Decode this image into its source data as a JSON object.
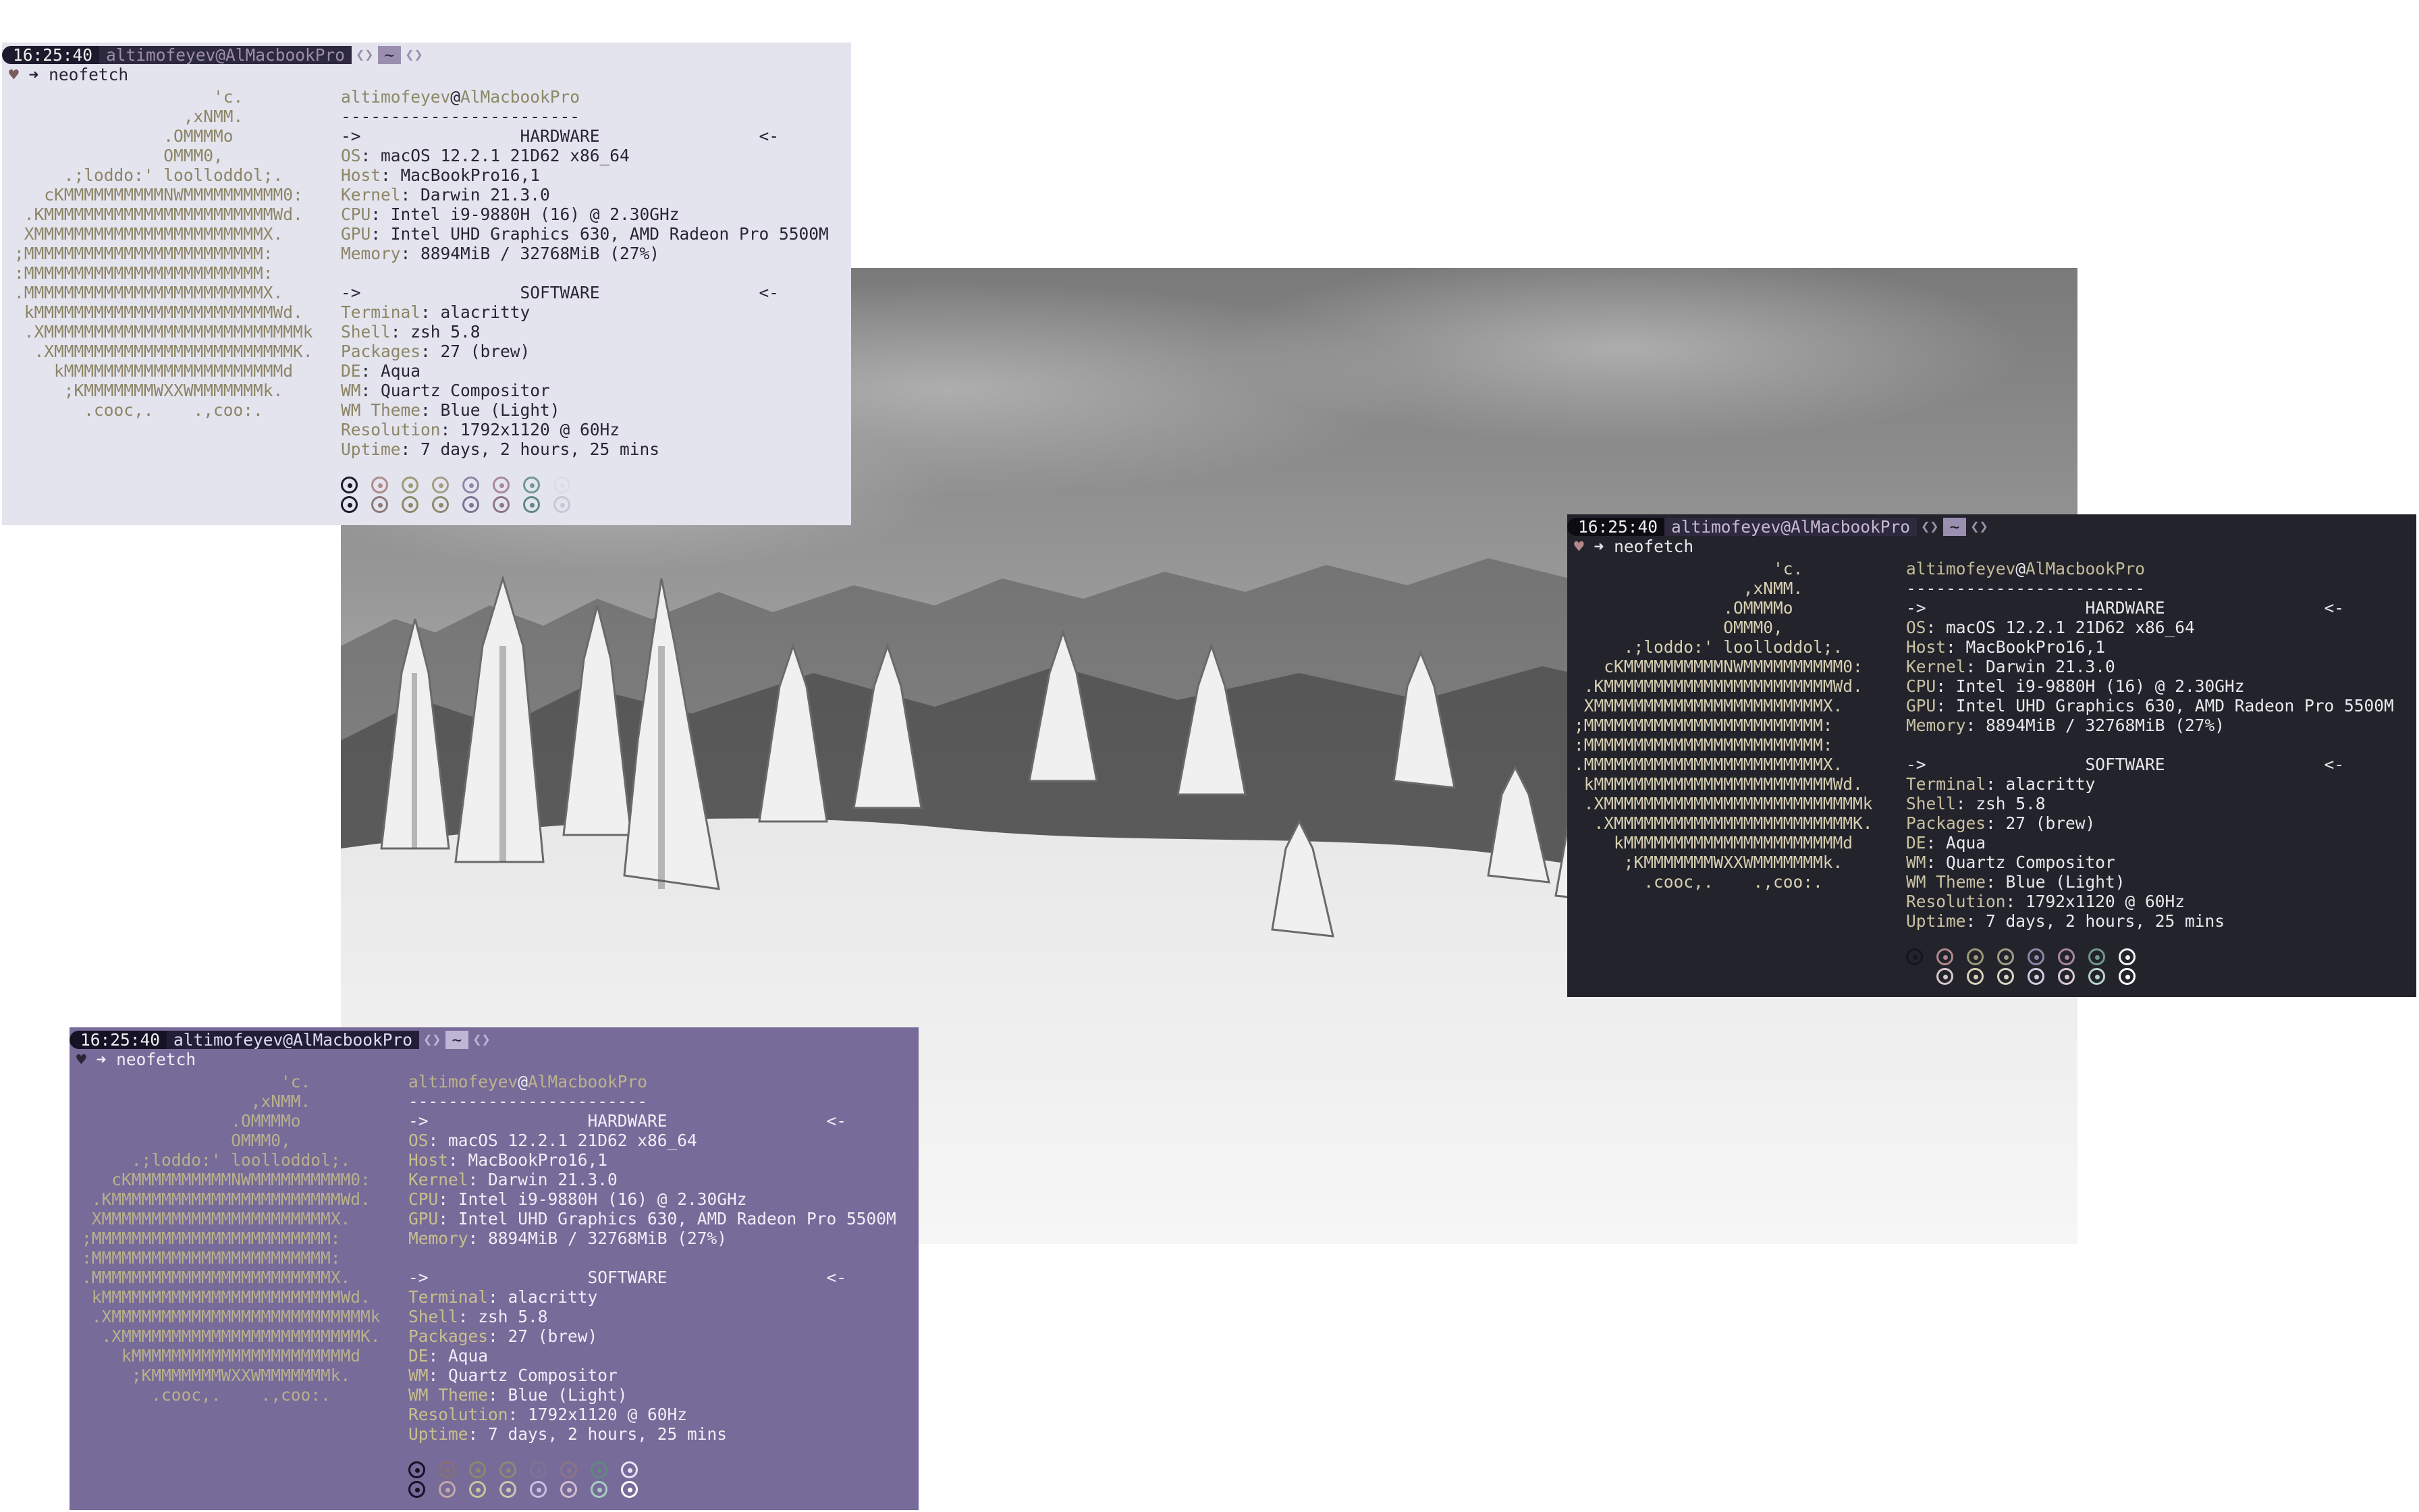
{
  "prompt": {
    "time": "16:25:40",
    "user_host": "altimofeyev@AlMacbookPro",
    "dir": "~",
    "heart": "♥",
    "arrow": "➜",
    "command": "neofetch"
  },
  "neofetch": {
    "user": "altimofeyev",
    "at": "@",
    "host": "AlMacbookPro",
    "separator": "------------------------",
    "hardware_header": "->                HARDWARE                <-",
    "software_header": "->                SOFTWARE                <-",
    "hardware": [
      {
        "key": "OS",
        "value": "macOS 12.2.1 21D62 x86_64"
      },
      {
        "key": "Host",
        "value": "MacBookPro16,1"
      },
      {
        "key": "Kernel",
        "value": "Darwin 21.3.0"
      },
      {
        "key": "CPU",
        "value": "Intel i9-9880H (16) @ 2.30GHz"
      },
      {
        "key": "GPU",
        "value": "Intel UHD Graphics 630, AMD Radeon Pro 5500M"
      },
      {
        "key": "Memory",
        "value": "8894MiB / 32768MiB (27%)"
      }
    ],
    "software": [
      {
        "key": "Terminal",
        "value": "alacritty"
      },
      {
        "key": "Shell",
        "value": "zsh 5.8"
      },
      {
        "key": "Packages",
        "value": "27 (brew)"
      },
      {
        "key": "DE",
        "value": "Aqua"
      },
      {
        "key": "WM",
        "value": "Quartz Compositor"
      },
      {
        "key": "WM Theme",
        "value": "Blue (Light)"
      },
      {
        "key": "Resolution",
        "value": "1792x1120 @ 60Hz"
      },
      {
        "key": "Uptime",
        "value": "7 days, 2 hours, 25 mins"
      }
    ],
    "logo": [
      "                    'c.",
      "                 ,xNMM.",
      "               .OMMMMo",
      "               OMMM0,",
      "     .;loddo:' loolloddol;.",
      "   cKMMMMMMMMMMNWMMMMMMMMMM0:",
      " .KMMMMMMMMMMMMMMMMMMMMMMMWd.",
      " XMMMMMMMMMMMMMMMMMMMMMMMX.",
      ";MMMMMMMMMMMMMMMMMMMMMMMM:",
      ":MMMMMMMMMMMMMMMMMMMMMMMM:",
      ".MMMMMMMMMMMMMMMMMMMMMMMMX.",
      " kMMMMMMMMMMMMMMMMMMMMMMMMWd.",
      " .XMMMMMMMMMMMMMMMMMMMMMMMMMMk",
      "  .XMMMMMMMMMMMMMMMMMMMMMMMMK.",
      "    kMMMMMMMMMMMMMMMMMMMMMMd",
      "     ;KMMMMMMMWXXWMMMMMMMk.",
      "       .cooc,.    .,coo:."
    ]
  },
  "themes": {
    "light": {
      "bg": "#e4e4ee",
      "dots_top": [
        "#1d1a2e",
        "#b08a8a",
        "#9c9a78",
        "#a29d86",
        "#8d86a8",
        "#a8879a",
        "#6f9a8e",
        "#dcdce6"
      ],
      "dots_bottom": [
        "#1d1a2e",
        "#8c7a7a",
        "#8c8a6a",
        "#8d8a72",
        "#7a7496",
        "#8e7486",
        "#5f8a7e",
        "#c8c8d4"
      ]
    },
    "dark": {
      "bg": "#23232b",
      "dots_top": [
        "#15151c",
        "#b08a8a",
        "#9c9a78",
        "#a29d86",
        "#8d86a8",
        "#a8879a",
        "#6f9a8e",
        "#f4f4f8"
      ],
      "dots_bottom": [
        "#23232b",
        "#d8c8c8",
        "#d4d0b8",
        "#d8d4c4",
        "#d0cce4",
        "#dcc8d4",
        "#b8d4cc",
        "#ffffff"
      ]
    },
    "purple": {
      "bg": "#766b99",
      "dots_top": [
        "#151226",
        "#8a7070",
        "#8c8a6a",
        "#8d8a72",
        "#7a7496",
        "#8e7486",
        "#5f8a7e",
        "#e8e4f4"
      ],
      "dots_bottom": [
        "#151226",
        "#c4a8a8",
        "#c8c49c",
        "#ccc8b0",
        "#c8c0e0",
        "#d4bccc",
        "#a8ccc0",
        "#ffffff"
      ]
    }
  }
}
